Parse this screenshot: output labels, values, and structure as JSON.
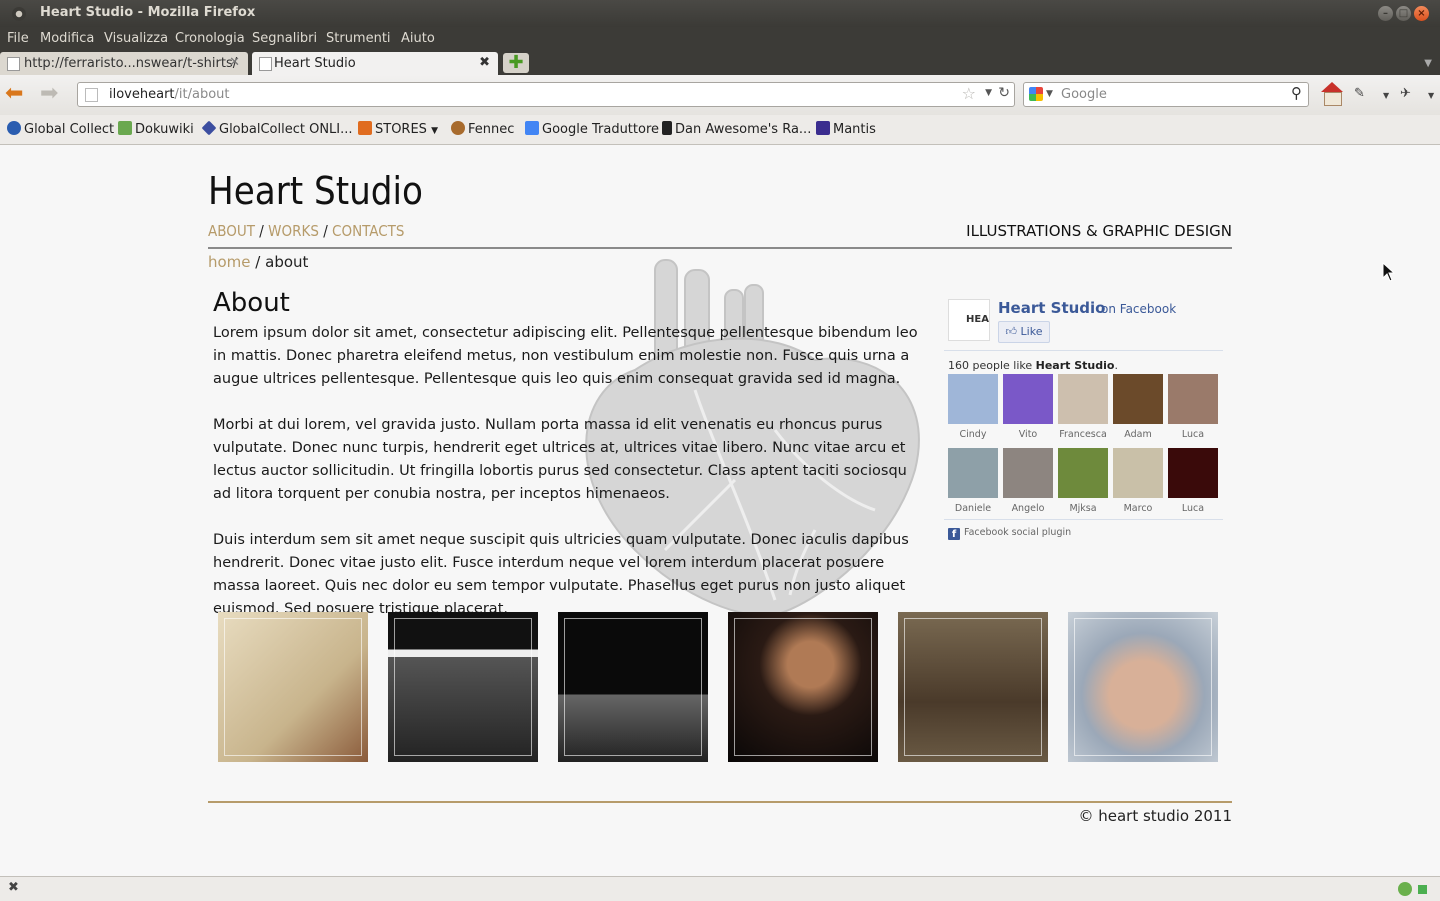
{
  "window": {
    "title": "Heart Studio - Mozilla Firefox"
  },
  "menu": [
    "File",
    "Modifica",
    "Visualizza",
    "Cronologia",
    "Segnalibri",
    "Strumenti",
    "Aiuto"
  ],
  "tabs": [
    {
      "label": "http://ferraristo...nswear/t-shirts/",
      "active": false
    },
    {
      "label": "Heart Studio",
      "active": true
    }
  ],
  "navbar": {
    "url_host": "iloveheart",
    "url_path": "/it/about",
    "search_placeholder": "Google"
  },
  "bookmarks": [
    {
      "label": "Global Collect",
      "icon": "globe-icon",
      "color": "#2a5db0"
    },
    {
      "label": "Dokuwiki",
      "icon": "dokuwiki-icon",
      "color": "#6aa84f"
    },
    {
      "label": "GlobalCollect ONLI...",
      "icon": "diamond-icon",
      "color": "#3c4ea0"
    },
    {
      "label": "STORES",
      "icon": "folder-icon",
      "color": "#e06c1f"
    },
    {
      "label": "Fennec",
      "icon": "fennec-icon",
      "color": "#a86b2d"
    },
    {
      "label": "Google Traduttore",
      "icon": "translate-icon",
      "color": "#4285f4"
    },
    {
      "label": "Dan Awesome's Ra...",
      "icon": "page-icon",
      "color": "#222222"
    },
    {
      "label": "Mantis",
      "icon": "mantis-icon",
      "color": "#3b2d8f"
    }
  ],
  "site": {
    "title": "Heart Studio",
    "nav": [
      "ABOUT",
      "WORKS",
      "CONTACTS"
    ],
    "nav_sep": "/",
    "tagline": "ILLUSTRATIONS & GRAPHIC DESIGN",
    "breadcrumb": {
      "home": "home",
      "sep": " / ",
      "current": "about"
    },
    "heading": "About",
    "paragraphs": [
      "Lorem ipsum dolor sit amet, consectetur adipiscing elit. Pellentesque pellentesque bibendum leo in mattis. Donec pharetra eleifend metus, non vestibulum enim molestie non. Fusce quis urna a augue ultrices pellentesque. Pellentesque quis leo quis enim consequat gravida sed id magna.",
      "Morbi at dui lorem, vel gravida justo. Nullam porta massa id elit venenatis eu rhoncus purus vulputate. Donec nunc turpis, hendrerit eget ultrices at, ultrices vitae libero. Nunc vitae arcu et lectus auctor sollicitudin. Ut fringilla lobortis purus sed consectetur. Class aptent taciti sociosqu ad litora torquent per conubia nostra, per inceptos himenaeos.",
      "Duis interdum sem sit amet neque suscipit quis ultricies quam vulputate. Donec iaculis dapibus hendrerit. Donec vitae justo elit. Fusce interdum neque vel lorem interdum placerat posuere massa laoreet. Quis nec dolor eu sem tempor vulputate. Phasellus eget purus non justo aliquet euismod. Sed posuere tristique placerat."
    ],
    "copyright": "© heart studio 2011"
  },
  "facebook": {
    "page_name": "Heart Studio",
    "on_facebook": "on Facebook",
    "like_label": "Like",
    "logo_text": "HEA",
    "count_prefix": "160 people like ",
    "count_name": "Heart Studio",
    "count_suffix": ".",
    "fans": [
      {
        "name": "Cindy",
        "color": "#9fb6d8"
      },
      {
        "name": "Vito",
        "color": "#7a58c8"
      },
      {
        "name": "Francesca",
        "color": "#cdbfae"
      },
      {
        "name": "Adam",
        "color": "#6b4a2a"
      },
      {
        "name": "Luca",
        "color": "#9a7a6a"
      },
      {
        "name": "Daniele",
        "color": "#8ea0a8"
      },
      {
        "name": "Angelo",
        "color": "#8d8580"
      },
      {
        "name": "Mjksa",
        "color": "#6e8a3c"
      },
      {
        "name": "Marco",
        "color": "#c9c0a8"
      },
      {
        "name": "Luca",
        "color": "#3a0a0a"
      }
    ],
    "plugin_label": "Facebook social plugin"
  },
  "gallery": [
    {
      "name": "poster-fight-thumb",
      "color": "#d8c8a4"
    },
    {
      "name": "bones-comfort-band-thumb",
      "color": "#3a3a3a"
    },
    {
      "name": "bones-comfort-logo-thumb",
      "color": "#222222"
    },
    {
      "name": "guitarist-live-thumb",
      "color": "#2a1a14"
    },
    {
      "name": "band-studio-thumb",
      "color": "#5a4a36"
    },
    {
      "name": "crying-man-thumb",
      "color": "#9ba8b8"
    }
  ],
  "colors": {
    "link": "#b69b6a",
    "fb_blue": "#3b5998"
  }
}
